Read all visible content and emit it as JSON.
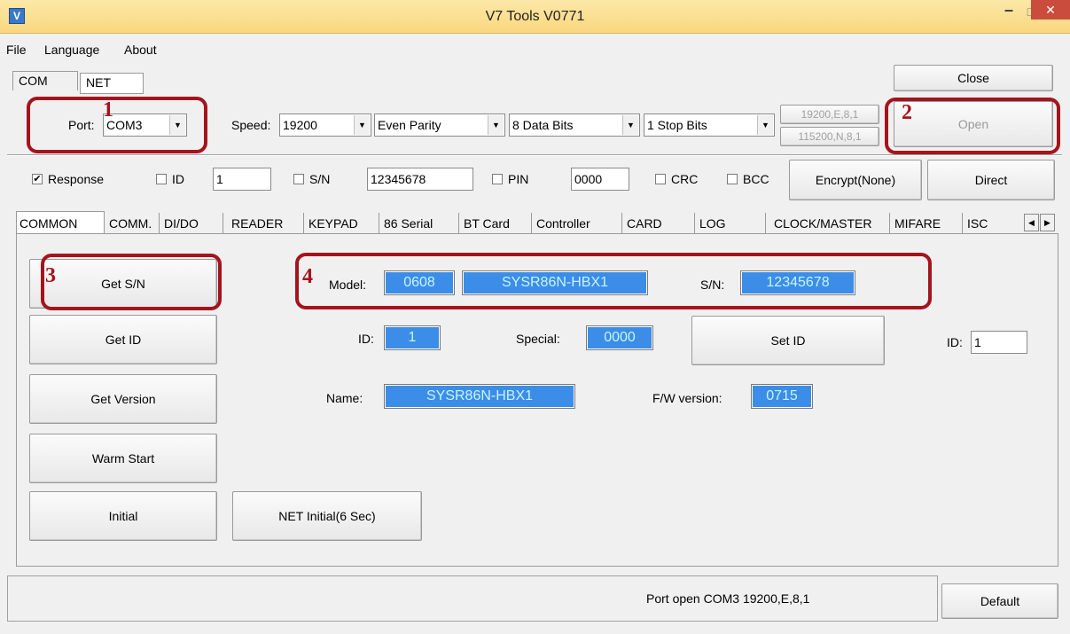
{
  "window": {
    "title": "V7 Tools V0771",
    "icon_char": "V",
    "close_glyph": "✕",
    "min_glyph": "–",
    "max_glyph": "□"
  },
  "menu": [
    "File",
    "Language",
    "About"
  ],
  "top_tabs": [
    "COM",
    "NET"
  ],
  "close_button": "Close",
  "port": {
    "label": "Port:",
    "value": "COM3",
    "speed_label": "Speed:",
    "speed": "19200",
    "parity": "Even Parity",
    "data_bits": "8 Data Bits",
    "stop_bits": "1 Stop Bits",
    "preset1": "19200,E,8,1",
    "preset2": "115200,N,8,1",
    "open_button": "Open"
  },
  "options": {
    "response": {
      "label": "Response",
      "checked": "✔"
    },
    "id": {
      "label": "ID",
      "value": "1"
    },
    "sn": {
      "label": "S/N",
      "value": "12345678"
    },
    "pin": {
      "label": "PIN",
      "value": "0000"
    },
    "crc": {
      "label": "CRC"
    },
    "bcc": {
      "label": "BCC"
    },
    "encrypt_button": "Encrypt(None)",
    "direct_button": "Direct"
  },
  "tabs": [
    "COMMON",
    "COMM.",
    "DI/DO",
    "READER",
    "KEYPAD",
    "86 Serial",
    "BT Card",
    "Controller",
    "CARD",
    "LOG",
    "CLOCK/MASTER",
    "MIFARE",
    "ISC"
  ],
  "common": {
    "get_sn": "Get S/N",
    "get_id": "Get ID",
    "get_version": "Get Version",
    "warm_start": "Warm Start",
    "initial": "Initial",
    "net_initial": "NET Initial(6 Sec)",
    "model_label": "Model:",
    "model_code": "0608",
    "model_name": "SYSR86N-HBX1",
    "sn_label": "S/N:",
    "sn_value": "12345678",
    "id_label": "ID:",
    "id_value": "1",
    "special_label": "Special:",
    "special_value": "0000",
    "set_id": "Set ID",
    "set_id_label": "ID:",
    "set_id_value": "1",
    "name_label": "Name:",
    "name_value": "SYSR86N-HBX1",
    "fw_label": "F/W version:",
    "fw_value": "0715"
  },
  "status": {
    "text": "Port open COM3 19200,E,8,1",
    "default_button": "Default"
  },
  "annotations": [
    "1",
    "2",
    "3",
    "4"
  ],
  "colors": {
    "annotation": "#a4141c",
    "field_bg": "#3b8de8",
    "field_text": "#c8f5ff"
  }
}
